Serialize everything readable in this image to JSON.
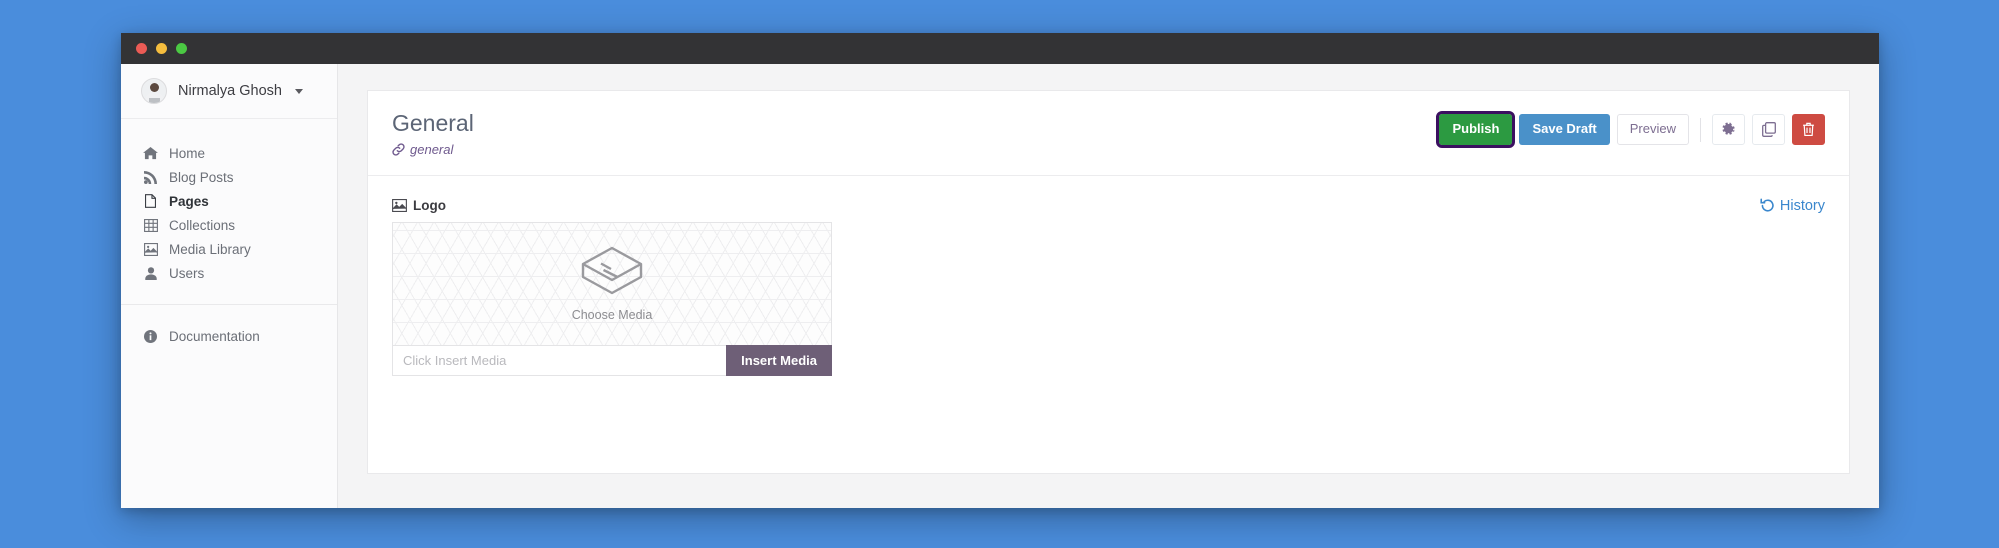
{
  "window": {
    "traffic_lights": [
      "close",
      "minimize",
      "maximize"
    ]
  },
  "sidebar": {
    "user": {
      "name": "Nirmalya Ghosh",
      "avatar_icon": "user-avatar-photo",
      "caret_icon": "caret-down-icon"
    },
    "items": [
      {
        "label": "Home",
        "icon": "home-icon",
        "active": false
      },
      {
        "label": "Blog Posts",
        "icon": "rss-icon",
        "active": false
      },
      {
        "label": "Pages",
        "icon": "file-icon",
        "active": true
      },
      {
        "label": "Collections",
        "icon": "table-icon",
        "active": false
      },
      {
        "label": "Media Library",
        "icon": "image-icon",
        "active": false
      },
      {
        "label": "Users",
        "icon": "user-icon",
        "active": false
      }
    ],
    "bottom_items": [
      {
        "label": "Documentation",
        "icon": "info-circle-icon"
      }
    ]
  },
  "header": {
    "title": "General",
    "slug": "general",
    "slug_icon": "link-icon",
    "actions": {
      "publish_label": "Publish",
      "save_draft_label": "Save Draft",
      "preview_label": "Preview",
      "settings_icon": "gear-icon",
      "duplicate_icon": "copy-icon",
      "delete_icon": "trash-icon"
    }
  },
  "main": {
    "history_label": "History",
    "history_icon": "undo-history-icon",
    "logo_field": {
      "label": "Logo",
      "label_icon": "image-icon",
      "dropzone_text": "Choose Media",
      "dropzone_icon": "media-stack-icon",
      "input_placeholder": "Click Insert Media",
      "input_value": "",
      "insert_button_label": "Insert Media"
    }
  },
  "colors": {
    "page_background": "#4a8ddc",
    "titlebar": "#333335",
    "publish_green": "#2c9a41",
    "publish_focus_ring": "#3b1060",
    "save_draft_blue": "#4a91c9",
    "accent_purple": "#7d6e91",
    "insert_media_purple": "#6e5f77",
    "danger_red": "#ce4b42",
    "history_blue": "#3a87cd"
  }
}
